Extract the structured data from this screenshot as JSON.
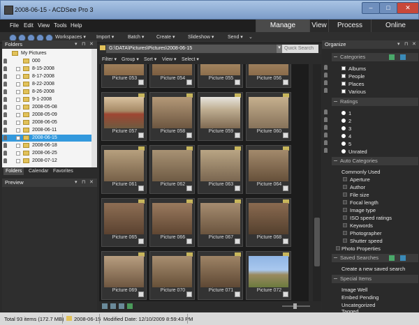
{
  "window": {
    "title": "2008-06-15 - ACDSee Pro 3"
  },
  "menu": {
    "items": [
      "File",
      "Edit",
      "View",
      "Tools",
      "Help"
    ]
  },
  "modes": [
    "Manage",
    "View",
    "Process",
    "Online"
  ],
  "toolbar": {
    "items": [
      "Workspaces ▾",
      "Import ▾",
      "Batch ▾",
      "Create ▾",
      "Slideshow ▾",
      "Send ▾",
      "⌄"
    ]
  },
  "folders_panel": {
    "title": "Folders",
    "items": [
      "My Pictures",
      "000",
      "8-15-2008",
      "8-17-2008",
      "8-22-2008",
      "8-26-2008",
      "9-1-2008",
      "2008-05-08",
      "2008-05-09",
      "2008-06-05",
      "2008-06-11",
      "2008-06-15",
      "2008-06-18",
      "2008-06-25",
      "2008-07-12"
    ],
    "tabs": [
      "Folders",
      "Calendar",
      "Favorites"
    ]
  },
  "preview_panel": {
    "title": "Preview"
  },
  "path": {
    "value": "G:\\DATA\\Pictures\\Pictures\\2008-06-15",
    "search_placeholder": "Quick Search"
  },
  "filterbar": {
    "items": [
      "Filter ▾",
      "Group ▾",
      "Sort ▾",
      "View ▾",
      "Select ▾"
    ]
  },
  "thumbnails": [
    "Picture 053",
    "Picture 054",
    "Picture 055",
    "Picture 056",
    "Picture 057",
    "Picture 058",
    "Picture 059",
    "Picture 060",
    "Picture 061",
    "Picture 062",
    "Picture 063",
    "Picture 064",
    "Picture 065",
    "Picture 066",
    "Picture 067",
    "Picture 068",
    "Picture 069",
    "Picture 070",
    "Picture 071",
    "Picture 072"
  ],
  "organize": {
    "title": "Organize",
    "categories": {
      "title": "Categories",
      "items": [
        "Albums",
        "People",
        "Places",
        "Various"
      ]
    },
    "ratings": {
      "title": "Ratings",
      "items": [
        "1",
        "2",
        "3",
        "4",
        "5",
        "Unrated"
      ]
    },
    "auto_categories": {
      "title": "Auto Categories",
      "group": "Commonly Used",
      "items": [
        "Aperture",
        "Author",
        "File size",
        "Focal length",
        "Image type",
        "ISO speed ratings",
        "Keywords",
        "Photographer",
        "Shutter speed"
      ],
      "extra": "Photo Properties"
    },
    "saved_searches": {
      "title": "Saved Searches",
      "item": "Create a new saved search"
    },
    "special_items": {
      "title": "Special Items",
      "items": [
        "Image Well",
        "Embed Pending",
        "Uncategorized",
        "Tagged"
      ]
    }
  },
  "status": {
    "total": "Total 93 items  (172.7 MB)",
    "folder": "2008-06-15",
    "modified": "Modified Date: 12/10/2009 8:59:43 PM"
  },
  "colors": {
    "accent": "#3399dd",
    "titlebar": "#8eaed6"
  }
}
